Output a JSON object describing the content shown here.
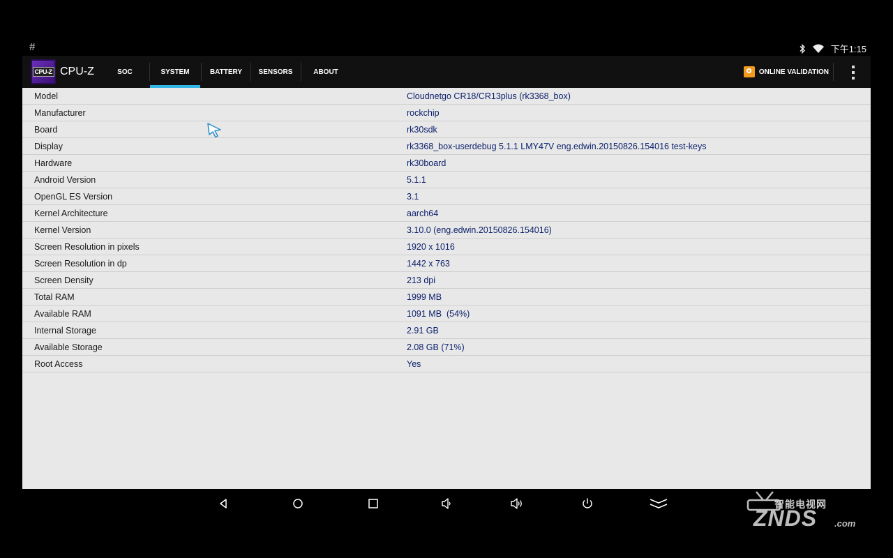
{
  "status": {
    "hash": "#",
    "time": "下午1:15"
  },
  "app": {
    "logo_text": "CPU-Z",
    "title": "CPU-Z"
  },
  "tabs": [
    {
      "label": "SOC"
    },
    {
      "label": "SYSTEM"
    },
    {
      "label": "BATTERY"
    },
    {
      "label": "SENSORS"
    },
    {
      "label": "ABOUT"
    }
  ],
  "active_tab": "SYSTEM",
  "validation": {
    "label": "ONLINE VALIDATION"
  },
  "rows": [
    {
      "label": "Model",
      "value": "Cloudnetgo CR18/CR13plus (rk3368_box)"
    },
    {
      "label": "Manufacturer",
      "value": "rockchip"
    },
    {
      "label": "Board",
      "value": "rk30sdk"
    },
    {
      "label": "Display",
      "value": "rk3368_box-userdebug 5.1.1 LMY47V eng.edwin.20150826.154016 test-keys"
    },
    {
      "label": "Hardware",
      "value": "rk30board"
    },
    {
      "label": "Android Version",
      "value": "5.1.1"
    },
    {
      "label": "OpenGL ES Version",
      "value": "3.1"
    },
    {
      "label": "Kernel Architecture",
      "value": "aarch64"
    },
    {
      "label": "Kernel Version",
      "value": "3.10.0 (eng.edwin.20150826.154016)"
    },
    {
      "label": "Screen Resolution in pixels",
      "value": "1920 x 1016"
    },
    {
      "label": "Screen Resolution in dp",
      "value": "1442 x 763"
    },
    {
      "label": "Screen Density",
      "value": "213 dpi"
    },
    {
      "label": "Total RAM",
      "value": "1999 MB"
    },
    {
      "label": "Available RAM",
      "value": "1091 MB  (54%)"
    },
    {
      "label": "Internal Storage",
      "value": "2.91 GB"
    },
    {
      "label": "Available Storage",
      "value": "2.08 GB (71%)"
    },
    {
      "label": "Root Access",
      "value": "Yes"
    }
  ],
  "nav_icons": [
    "back-icon",
    "home-icon",
    "recents-icon",
    "volume-down-icon",
    "volume-up-icon",
    "power-icon",
    "collapse-icon"
  ],
  "watermark": {
    "top": "智能电视网",
    "main": "ZNDS",
    "suffix": ".com"
  },
  "colors": {
    "accent": "#33b5e5",
    "value_text": "#0b1f6b",
    "app_bar": "#111111",
    "content_bg": "#e8e8e8"
  }
}
